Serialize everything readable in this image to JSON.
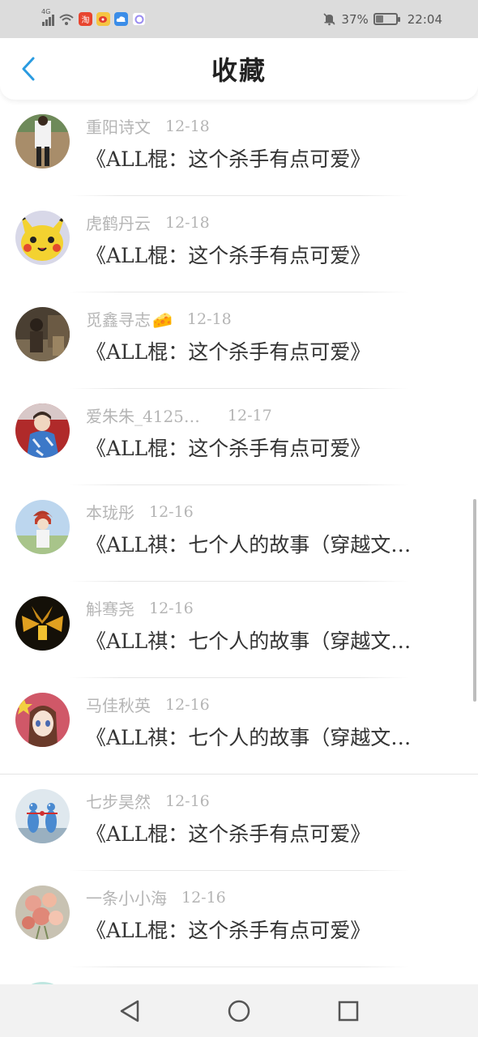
{
  "status_bar": {
    "network": "4G",
    "battery_percent": "37%",
    "battery_level": 0.37,
    "time": "22:04",
    "app_icons": [
      "taobao-icon",
      "weibo-icon",
      "cloud-icon",
      "assistant-icon"
    ],
    "taobao_glyph": "淘"
  },
  "header": {
    "title": "收藏",
    "accent_color": "#2a9be0"
  },
  "items": [
    {
      "author": "重阳诗文",
      "date": "12-18",
      "title": "《ALL棍：这个杀手有点可爱》",
      "avatar": "person-photo-avatar"
    },
    {
      "author": "虎鹤丹云",
      "date": "12-18",
      "title": "《ALL棍：这个杀手有点可爱》",
      "avatar": "pikachu-avatar"
    },
    {
      "author": "觅鑫寻志",
      "emoji": "🧀",
      "date": "12-18",
      "title": "《ALL棍：这个杀手有点可爱》",
      "avatar": "dark-photo-avatar"
    },
    {
      "author": "爱朱朱_4125…",
      "date": "12-17",
      "title": "《ALL棍：这个杀手有点可爱》",
      "avatar": "blue-outfit-avatar"
    },
    {
      "author": "本珑彤",
      "date": "12-16",
      "title": "《ALL祺：七个人的故事（穿越文…",
      "avatar": "anime-sky-avatar"
    },
    {
      "author": "斛骞尧",
      "date": "12-16",
      "title": "《ALL祺：七个人的故事（穿越文…",
      "avatar": "golden-mask-avatar"
    },
    {
      "author": "马佳秋英",
      "date": "12-16",
      "title": "《ALL祺：七个人的故事（穿越文…",
      "avatar": "anime-girl-avatar"
    },
    {
      "author": "七步昊然",
      "date": "12-16",
      "title": "《ALL棍：这个杀手有点可爱》",
      "avatar": "bowling-pins-avatar"
    },
    {
      "author": "一条小小海",
      "date": "12-16",
      "title": "《ALL棍：这个杀手有点可爱》",
      "avatar": "flowers-avatar"
    }
  ],
  "nav_bar": {
    "buttons": [
      "back-triangle-icon",
      "home-circle-icon",
      "recents-square-icon"
    ]
  }
}
